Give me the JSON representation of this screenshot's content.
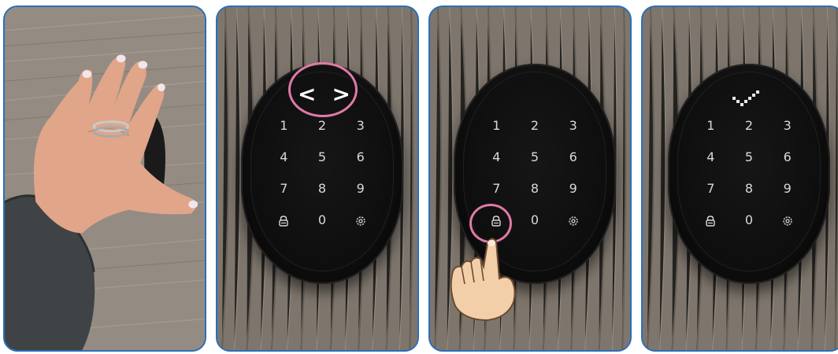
{
  "panels": [
    {
      "id": "hand-on-lock"
    },
    {
      "id": "arrows-shown",
      "overlay": "< >"
    },
    {
      "id": "press-lock-key"
    },
    {
      "id": "check-shown"
    }
  ],
  "keypad": {
    "row1": [
      "1",
      "2",
      "3"
    ],
    "row2": [
      "4",
      "5",
      "6"
    ],
    "row3": [
      "7",
      "8",
      "9"
    ],
    "row4": [
      "lock-icon",
      "0",
      "gear-icon"
    ]
  },
  "arrows": {
    "left": "<",
    "right": ">"
  },
  "colors": {
    "frame": "#2b6fb8",
    "highlight": "#e07aa6",
    "wood": "#7b7268"
  }
}
